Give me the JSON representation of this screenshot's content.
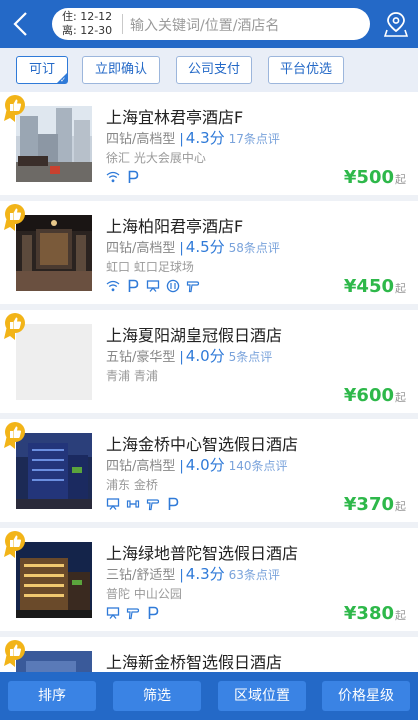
{
  "header": {
    "check_in": "住: 12-12",
    "check_out": "离: 12-30",
    "search_placeholder": "输入关键词/位置/酒店名",
    "back_icon": "chevron-left-icon",
    "map_icon": "map-pin-icon"
  },
  "filters": [
    {
      "label": "可订",
      "selected": true
    },
    {
      "label": "立即确认",
      "selected": false
    },
    {
      "label": "公司支付",
      "selected": false
    },
    {
      "label": "平台优选",
      "selected": false
    }
  ],
  "hotels": [
    {
      "name": "上海宜林君亭酒店F",
      "level": "四钻/高档型",
      "score": "4.3分",
      "reviews": "17条点评",
      "location": "徐汇  光大会展中心",
      "amenities": [
        "wifi-icon",
        "parking-icon"
      ],
      "price": "¥500",
      "suffix": "起"
    },
    {
      "name": "上海柏阳君亭酒店F",
      "level": "四钻/高档型",
      "score": "4.5分",
      "reviews": "58条点评",
      "location": "虹口  虹口足球场",
      "amenities": [
        "wifi-icon",
        "parking-icon",
        "meeting-room-icon",
        "restaurant-icon",
        "hairdryer-icon"
      ],
      "price": "¥450",
      "suffix": "起"
    },
    {
      "name": "上海夏阳湖皇冠假日酒店",
      "level": "五钻/豪华型",
      "score": "4.0分",
      "reviews": "5条点评",
      "location": "青浦  青浦",
      "amenities": [],
      "price": "¥600",
      "suffix": "起"
    },
    {
      "name": "上海金桥中心智选假日酒店",
      "level": "四钻/高档型",
      "score": "4.0分",
      "reviews": "140条点评",
      "location": "浦东  金桥",
      "amenities": [
        "meeting-room-icon",
        "gym-icon",
        "hairdryer-icon",
        "parking-icon"
      ],
      "price": "¥370",
      "suffix": "起"
    },
    {
      "name": "上海绿地普陀智选假日酒店",
      "level": "三钻/舒适型",
      "score": "4.3分",
      "reviews": "63条点评",
      "location": "普陀  中山公园",
      "amenities": [
        "meeting-room-icon",
        "hairdryer-icon",
        "parking-icon"
      ],
      "price": "¥380",
      "suffix": "起"
    },
    {
      "name": "上海新金桥智选假日酒店"
    }
  ],
  "bottom": [
    "排序",
    "筛选",
    "区域位置",
    "价格星级"
  ],
  "colors": {
    "brand": "#2469c7",
    "price": "#2eb84a",
    "score": "#2f7ad8",
    "badge": "#f2b418"
  }
}
